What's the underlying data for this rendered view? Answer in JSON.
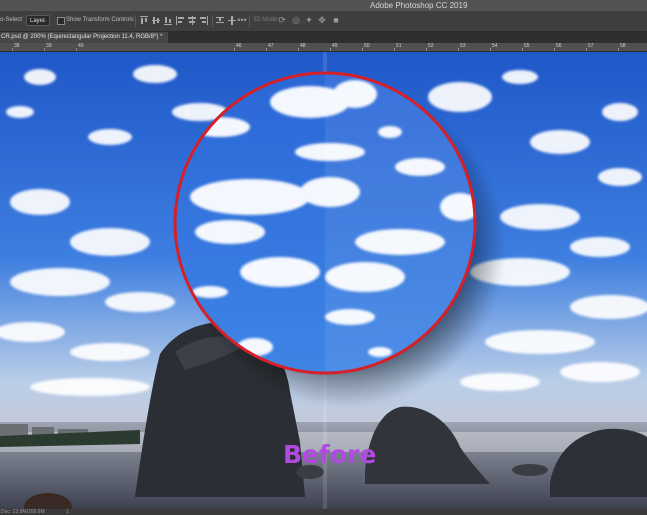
{
  "window": {
    "title": "Adobe Photoshop CC 2019"
  },
  "options_bar": {
    "auto_select_label": "o-Select",
    "layer_dropdown": "Layer",
    "show_transform_controls": "Show Transform Controls",
    "three_d_mode": "3D Mode",
    "more_label": "•••"
  },
  "document_tab": {
    "label": "CR.psd @ 200% (Equirectangular Projection 11.4, RGB/8*) *"
  },
  "ruler": {
    "ticks": [
      "38",
      "39",
      "40",
      "46",
      "47",
      "48",
      "49",
      "50",
      "51",
      "52",
      "53",
      "54",
      "55",
      "56",
      "57",
      "58",
      "59",
      "60",
      "61"
    ]
  },
  "canvas": {
    "overlay_label": "Before",
    "overlay_color": "#b04ae0",
    "magnifier_ring_color": "#d5202a"
  },
  "status_bar": {
    "doc_info": "Doc: 23.9M/200.6M",
    "right_indicator": "1"
  }
}
